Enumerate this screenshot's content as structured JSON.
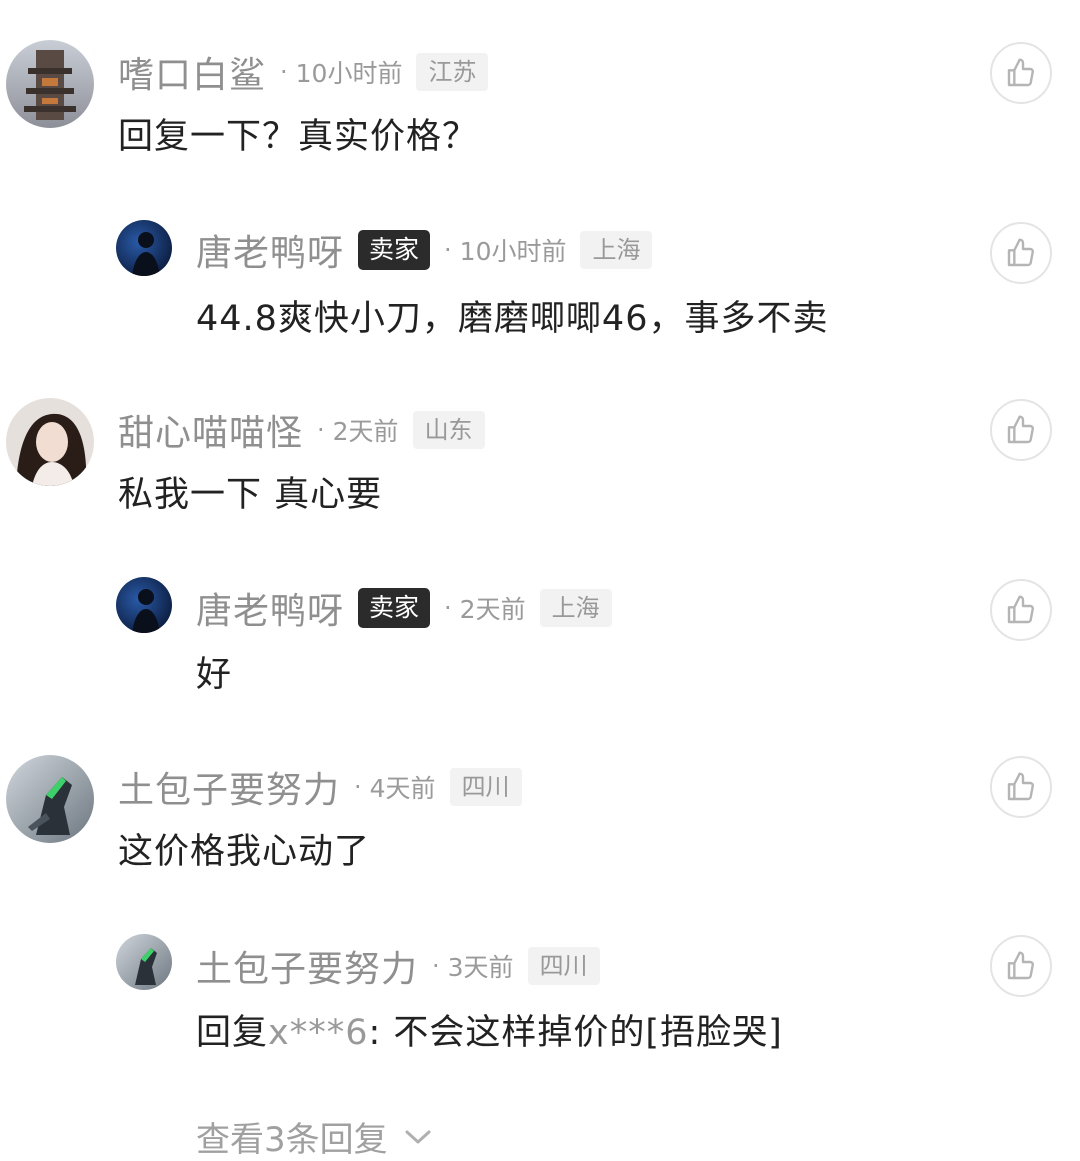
{
  "comments": [
    {
      "username": "嗜口白鲨",
      "seller_badge": "",
      "time": "10小时前",
      "location": "江苏",
      "text": "回复一下？真实价格？",
      "mention": "",
      "after_mention": ""
    },
    {
      "username": "唐老鸭呀",
      "seller_badge": "卖家",
      "time": "10小时前",
      "location": "上海",
      "text": "44.8爽快小刀，磨磨唧唧46，事多不卖",
      "mention": "",
      "after_mention": ""
    },
    {
      "username": "甜心喵喵怪",
      "seller_badge": "",
      "time": "2天前",
      "location": "山东",
      "text": "私我一下 真心要",
      "mention": "",
      "after_mention": ""
    },
    {
      "username": "唐老鸭呀",
      "seller_badge": "卖家",
      "time": "2天前",
      "location": "上海",
      "text": "好",
      "mention": "",
      "after_mention": ""
    },
    {
      "username": "土包子要努力",
      "seller_badge": "",
      "time": "4天前",
      "location": "四川",
      "text": "这价格我心动了",
      "mention": "",
      "after_mention": ""
    },
    {
      "username": "土包子要努力",
      "seller_badge": "",
      "time": "3天前",
      "location": "四川",
      "text": "回复",
      "mention": "x***6",
      "after_mention": ": 不会这样掉价的[捂脸哭]"
    }
  ],
  "dot_separator": "·",
  "view_more": "查看3条回复",
  "icons": {
    "like": "thumbs-up-icon",
    "expand": "chevron-down-icon"
  },
  "colors": {
    "username": "#8f8f8f",
    "seller_badge_bg": "#2b2b2b",
    "location_bg": "#f2f2f2",
    "text": "#222222"
  }
}
